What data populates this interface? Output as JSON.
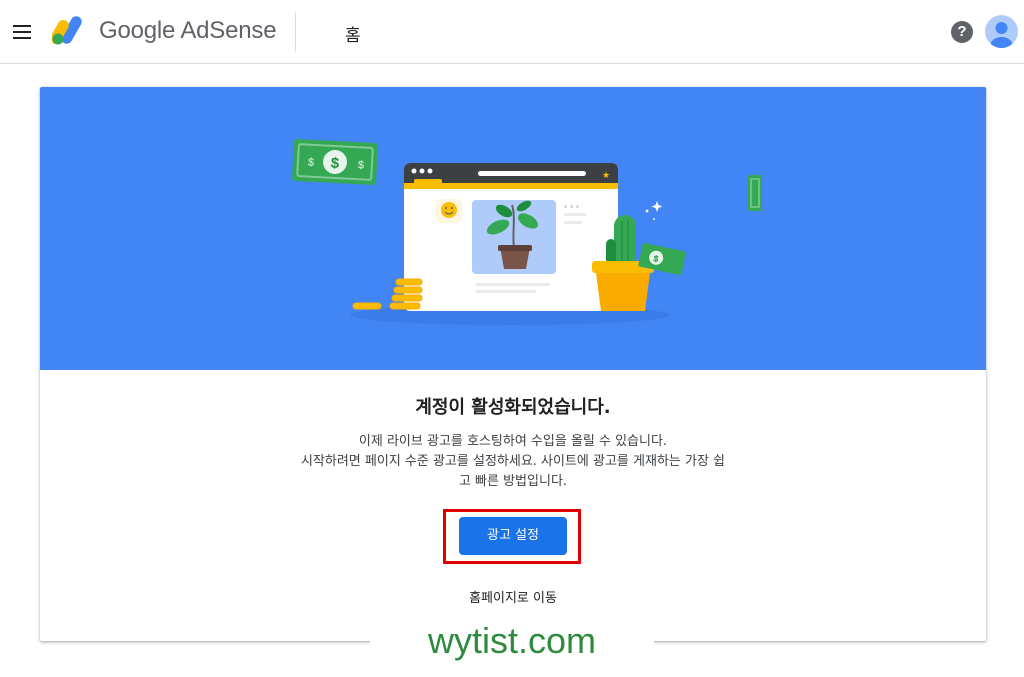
{
  "header": {
    "brand": "Google AdSense",
    "page_title": "홈",
    "help_glyph": "?"
  },
  "card": {
    "headline": "계정이 활성화되었습니다.",
    "description_lines": [
      "이제 라이브 광고를 호스팅하여 수입을 올릴 수 있습니다.",
      "시작하려면 페이지 수준 광고를 설정하세요. 사이트에 광고를 게재하는 가장 쉽",
      "고 빠른 방법입니다."
    ],
    "primary_button": "광고 설정",
    "secondary_link": "홈페이지로 이동"
  },
  "watermark": "wytist.com",
  "colors": {
    "hero_bg": "#4285f4",
    "primary": "#1a73e8",
    "highlight": "#e00000",
    "watermark": "#2e8b3e"
  },
  "icons": [
    "menu-icon",
    "adsense-logo-icon",
    "help-icon",
    "avatar-icon",
    "money-bill-icon",
    "browser-window-icon",
    "plant-icon",
    "cactus-icon",
    "coin-stack-icon",
    "smiley-icon",
    "sparkle-icon"
  ]
}
